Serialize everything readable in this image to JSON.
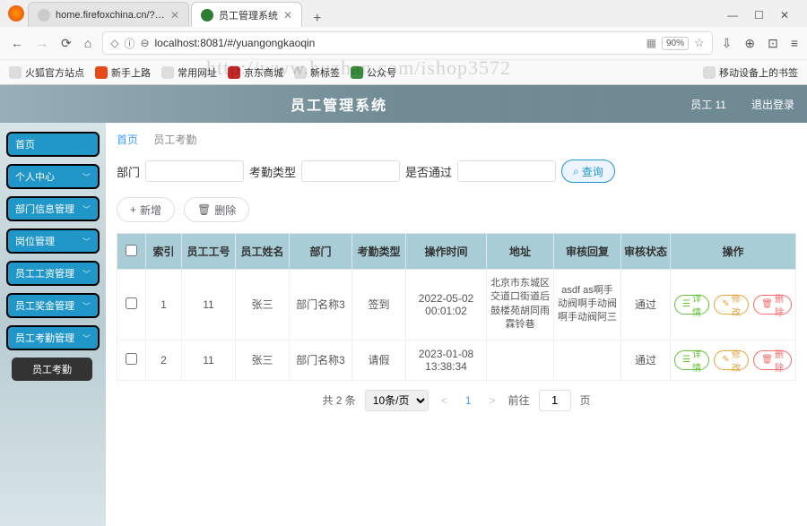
{
  "browser": {
    "tabs": [
      {
        "title": "home.firefoxchina.cn/?from=ext"
      },
      {
        "title": "员工管理系统"
      }
    ],
    "address": "localhost:8081/#/yuangongkaoqin",
    "zoom": "90%",
    "bookmarks": [
      "火狐官方站点",
      "新手上路",
      "常用网址",
      "京东商城",
      "新标签",
      "公众号"
    ],
    "mobile_bookmark": "移动设备上的书签",
    "watermark": "http://www.huzhan.com/ishop3572"
  },
  "header": {
    "title": "员工管理系统",
    "user_label": "员工 11",
    "logout": "退出登录"
  },
  "sidebar": {
    "items": [
      {
        "label": "首页",
        "chev": false
      },
      {
        "label": "个人中心",
        "chev": true
      },
      {
        "label": "部门信息管理",
        "chev": true
      },
      {
        "label": "岗位管理",
        "chev": true
      },
      {
        "label": "员工工资管理",
        "chev": true
      },
      {
        "label": "员工奖金管理",
        "chev": true
      },
      {
        "label": "员工考勤管理",
        "chev": true
      }
    ],
    "sub": "员工考勤"
  },
  "crumb": {
    "home": "首页",
    "current": "员工考勤"
  },
  "filters": {
    "dept_label": "部门",
    "type_label": "考勤类型",
    "pass_label": "是否通过",
    "query_label": "查询"
  },
  "toolbar": {
    "add": "新增",
    "delete": "删除"
  },
  "table": {
    "headers": [
      "索引",
      "员工工号",
      "员工姓名",
      "部门",
      "考勤类型",
      "操作时间",
      "地址",
      "审核回复",
      "审核状态",
      "操作"
    ],
    "rows": [
      {
        "idx": "1",
        "empno": "11",
        "name": "张三",
        "dept": "部门名称3",
        "type": "签到",
        "time": "2022-05-02 00:01:02",
        "addr": "北京市东城区交道口街道后鼓楼苑胡同雨霖铃巷",
        "reply": "asdf as啊手动阀啊手动阀啊手动阀阿三",
        "status": "通过"
      },
      {
        "idx": "2",
        "empno": "11",
        "name": "张三",
        "dept": "部门名称3",
        "type": "请假",
        "time": "2023-01-08 13:38:34",
        "addr": "",
        "reply": "",
        "status": "通过"
      }
    ],
    "row_actions": {
      "detail": "详情",
      "edit": "修改",
      "delete": "删除"
    }
  },
  "pager": {
    "total_label": "共 2 条",
    "page_size": "10条/页",
    "current": "1",
    "goto_label": "前往",
    "page_input": "1",
    "page_suffix": "页"
  }
}
